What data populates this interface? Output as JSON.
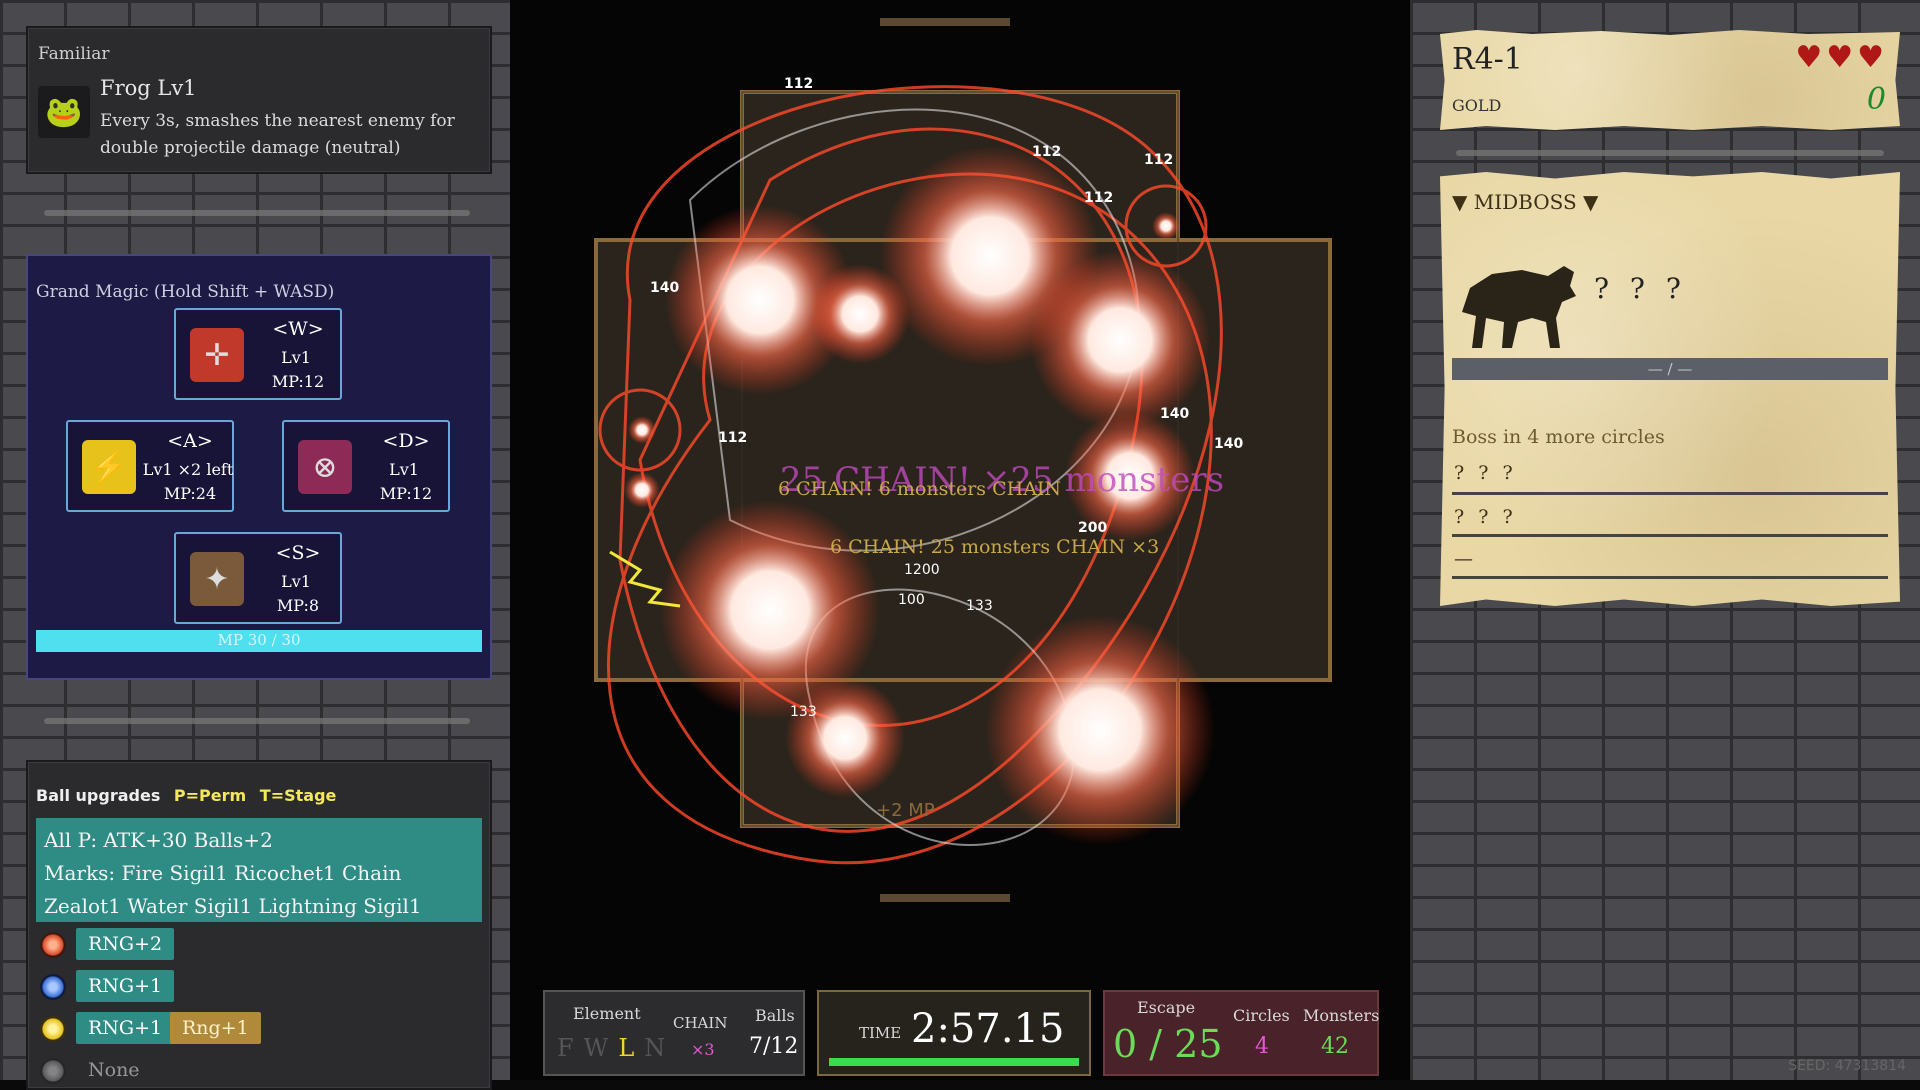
{
  "familiar": {
    "header": "Familiar",
    "name": "Frog  Lv1",
    "description": "Every 3s, smashes the nearest enemy for double projectile damage (neutral)",
    "icon": "frog-icon"
  },
  "grand_magic": {
    "header": "Grand Magic (Hold Shift + WASD)",
    "spells": [
      {
        "key": "<W>",
        "level": "Lv1",
        "mp": "MP:12",
        "icon": "crosshair-icon"
      },
      {
        "key": "<A>",
        "level": "Lv1  ×2 left",
        "mp": "MP:24",
        "icon": "lightning-figure-icon"
      },
      {
        "key": "<D>",
        "level": "Lv1",
        "mp": "MP:12",
        "icon": "cross-circle-icon"
      },
      {
        "key": "<S>",
        "level": "Lv1",
        "mp": "MP:8",
        "icon": "wand-icon"
      }
    ],
    "mp_text": "MP 30 / 30",
    "mp_fraction": 1.0
  },
  "ball_upgrades": {
    "header": "Ball upgrades",
    "perm_legend": "P=Perm",
    "stage_legend": "T=Stage",
    "summary_lines": [
      "All P: ATK+30 Balls+2",
      "Marks: Fire Sigil1  Ricochet1  Chain",
      "Zealot1  Water Sigil1  Lightning Sigil1"
    ],
    "rows": [
      {
        "orb_color": "#d94a2a",
        "chips": [
          "RNG+2"
        ]
      },
      {
        "orb_color": "#3b6fd6",
        "chips": [
          "RNG+1"
        ]
      },
      {
        "orb_color": "#e6c21a",
        "chips": [
          "RNG+1",
          "Rng+1"
        ]
      },
      {
        "orb_color": "#888888",
        "chips": [
          "None"
        ]
      }
    ]
  },
  "stage": {
    "title": "R4-1",
    "gold_label": "GOLD",
    "gold_value": "0",
    "hearts": "♥♥♥"
  },
  "boss": {
    "header": "▼ MIDBOSS ▼",
    "name": "? ? ?",
    "hp_text": "— / —",
    "message": "Boss in 4 more circles",
    "entries": [
      "? ? ?",
      "? ? ?",
      "—"
    ]
  },
  "hud": {
    "element_label": "Element",
    "elements": [
      "F",
      "W",
      "L",
      "N"
    ],
    "active_element": "L",
    "chain_label": "CHAIN",
    "chain_value": "×3",
    "balls_label": "Balls",
    "balls_value": "7/12",
    "time_label": "TIME",
    "time_value": "2:57.15",
    "escape_label": "Escape",
    "escape_value": "0 / 25",
    "circles_label": "Circles",
    "circles_value": "4",
    "monsters_label": "Monsters",
    "monsters_value": "42"
  },
  "battlefield": {
    "chain_banner_1": "25 CHAIN! ×25 monsters",
    "chain_banner_2": "6 CHAIN! 6 monsters CHAIN",
    "chain_banner_3": "6 CHAIN! 25 monsters CHAIN ×3",
    "mp_popup": "+2 MP",
    "damage_numbers": [
      "112",
      "112",
      "112",
      "112",
      "140",
      "140",
      "140",
      "112",
      "200",
      "1200",
      "100",
      "133",
      "133",
      "140",
      "140"
    ]
  },
  "seed": "SEED: 47313814"
}
